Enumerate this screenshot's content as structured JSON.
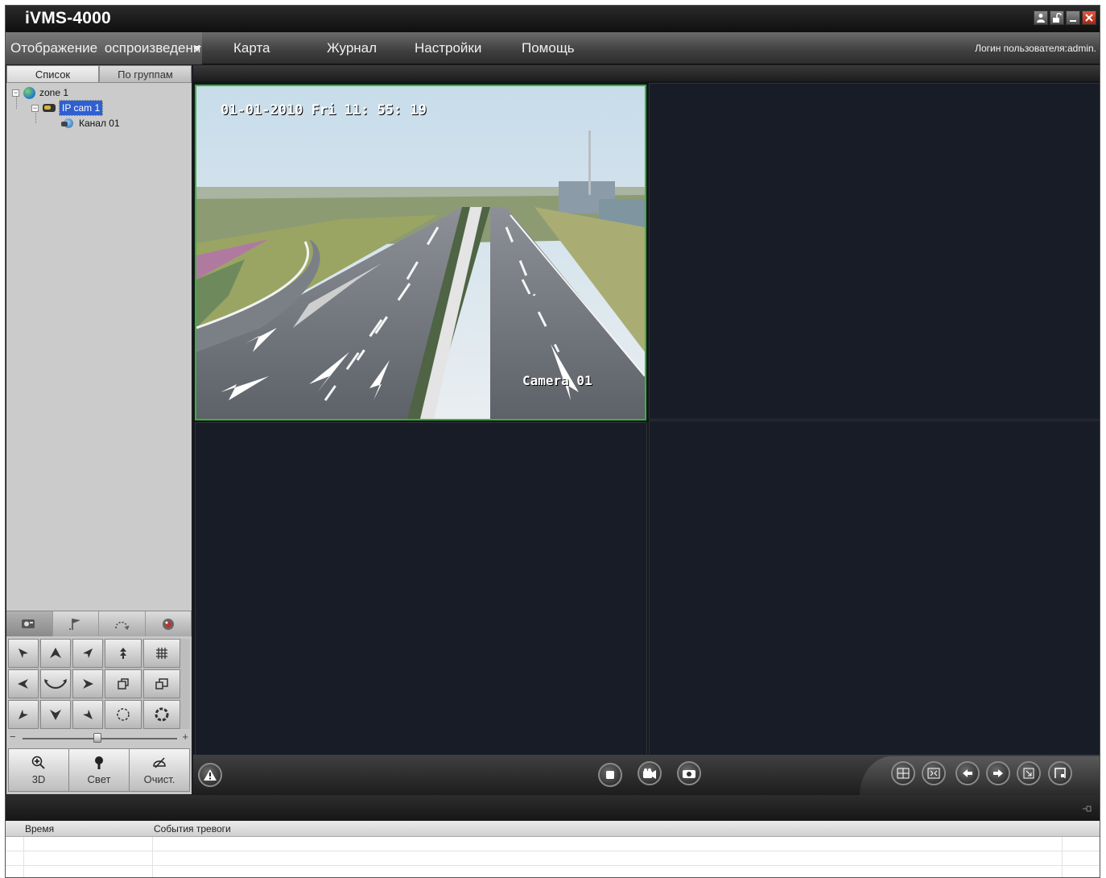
{
  "app": {
    "title": "iVMS-4000"
  },
  "window_buttons": [
    "user-icon",
    "lock-icon",
    "minimize-icon",
    "close-icon"
  ],
  "menu": {
    "items": [
      "Отображение",
      "оспроизведени",
      "Карта",
      "Журнал",
      "Настройки",
      "Помощь"
    ],
    "login": "Логин пользователя:admin."
  },
  "left_panel": {
    "tabs": [
      "Список",
      "По группам"
    ],
    "tree": {
      "zone": "zone 1",
      "device": "IP cam 1",
      "channel": "Канал 01"
    },
    "ptz_tabs": [
      "ptz-icon",
      "preset-flag-icon",
      "patrol-icon",
      "pattern-icon"
    ],
    "ptz_actions": {
      "zoom3d": "3D",
      "light": "Свет",
      "clear": "Очист."
    }
  },
  "video": {
    "osd_datetime": "01-01-2010  Fri 11: 55: 19",
    "osd_camera": "Camera 01"
  },
  "alarm": {
    "columns": [
      "Время",
      "События тревоги"
    ]
  },
  "colors": {
    "active_pane_border": "#35b535",
    "selection": "#2f5fd0",
    "close_button": "#c0391f"
  }
}
